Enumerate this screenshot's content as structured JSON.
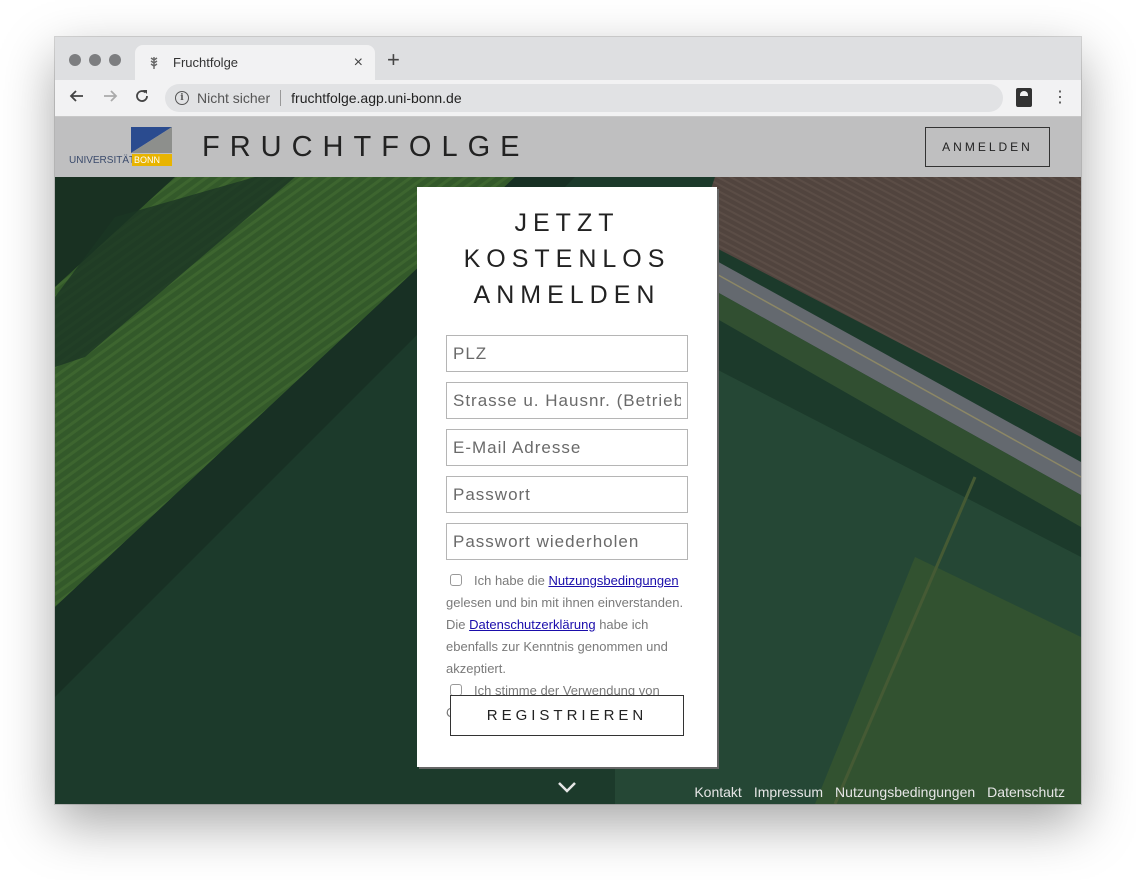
{
  "browser": {
    "tab_title": "Fruchtfolge",
    "tab_close": "×",
    "new_tab": "+",
    "security_label": "Nicht sicher",
    "url": "fruchtfolge.agp.uni-bonn.de",
    "menu": "⋮"
  },
  "header": {
    "logo_text": "UNIVERSITÄT",
    "logo_bonn": "BONN",
    "brand": "FRUCHTFOLGE",
    "login_label": "ANMELDEN"
  },
  "signup": {
    "title_line1": "JETZT KOSTENLOS",
    "title_line2": "ANMELDEN",
    "fields": {
      "plz": "PLZ",
      "street": "Strasse u. Hausnr. (Betrieb)",
      "email": "E-Mail Adresse",
      "password": "Passwort",
      "password_repeat": "Passwort wiederholen"
    },
    "terms": {
      "prefix": "Ich habe die ",
      "terms_link": "Nutzungsbedingungen",
      "middle": " gelesen und bin mit ihnen einverstanden. Die ",
      "privacy_link": "Datenschutzerklärung",
      "suffix": " habe ich ebenfalls zur Kenntnis genommen und akzeptiert."
    },
    "cookies": "Ich stimme der Verwendung von Cookies auf der Webseite zu.",
    "register_label": "REGISTRIEREN"
  },
  "footer": {
    "links": [
      "Kontakt",
      "Impressum",
      "Nutzungsbedingungen",
      "Datenschutz"
    ]
  }
}
